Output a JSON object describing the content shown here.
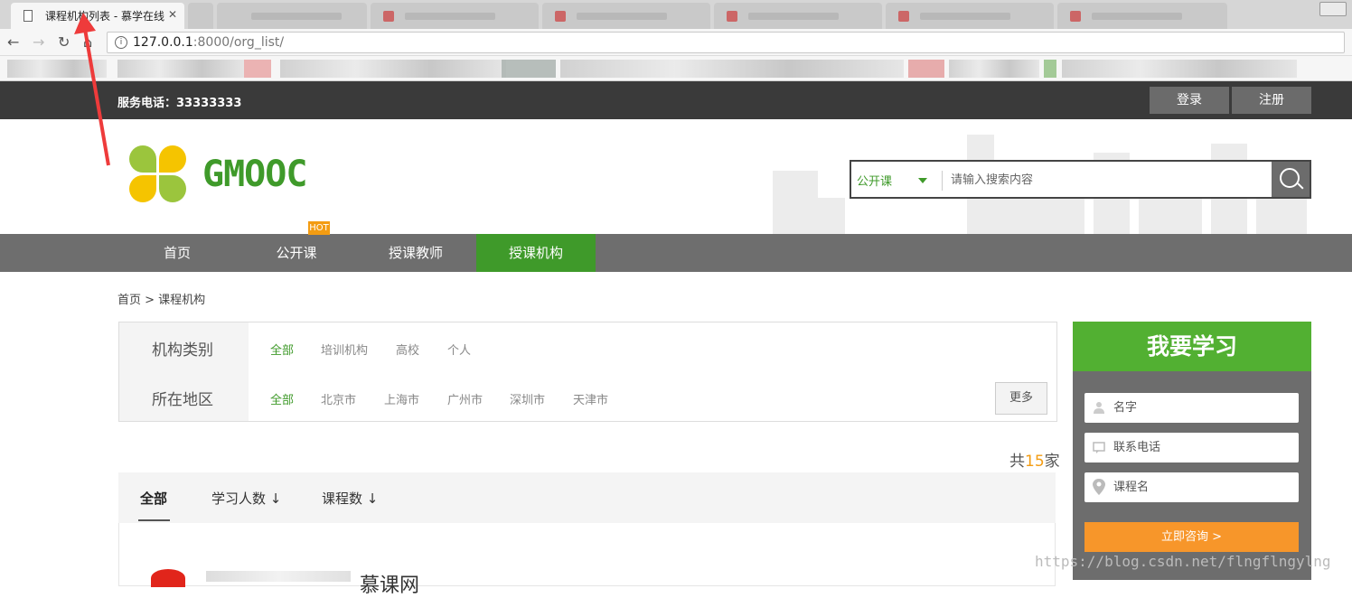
{
  "browser": {
    "active_tab_title": "课程机构列表 - 慕学在线",
    "url_host": "127.0.0.1",
    "url_path": ":8000/org_list/"
  },
  "topbar": {
    "hotline_label": "服务电话：",
    "hotline_number": "33333333",
    "login": "登录",
    "register": "注册"
  },
  "header": {
    "brand": "GMOOC",
    "search_type": "公开课",
    "search_placeholder": "请输入搜索内容"
  },
  "nav": {
    "items": [
      {
        "label": "首页"
      },
      {
        "label": "公开课"
      },
      {
        "label": "授课教师"
      },
      {
        "label": "授课机构"
      }
    ],
    "hot_badge": "HOT"
  },
  "breadcrumb": "首页 > 课程机构",
  "filters": {
    "category_label": "机构类别",
    "category_options": [
      "全部",
      "培训机构",
      "高校",
      "个人"
    ],
    "region_label": "所在地区",
    "region_options": [
      "全部",
      "北京市",
      "上海市",
      "广州市",
      "深圳市",
      "天津市"
    ],
    "more": "更多"
  },
  "total": {
    "prefix": "共",
    "count": "15",
    "suffix": "家"
  },
  "sort_tabs": [
    "全部",
    "学习人数 ↓",
    "课程数 ↓"
  ],
  "org_first": {
    "name_visible": "慕课网"
  },
  "side": {
    "title": "我要学习",
    "name_placeholder": "名字",
    "phone_placeholder": "联系电话",
    "course_placeholder": "课程名",
    "submit": "立即咨询 >"
  },
  "watermark": "https://blog.csdn.net/flngflngylng",
  "colors": {
    "brand_green": "#3f9a2a",
    "side_green": "#52b032",
    "accent_orange": "#f39c12",
    "topbar": "#3a3a3a",
    "nav_gray": "#6e6e6e"
  }
}
